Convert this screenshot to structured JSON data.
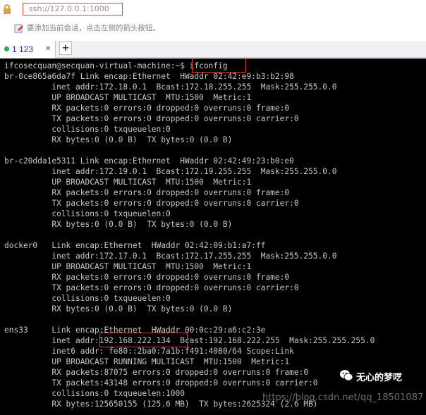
{
  "address_bar": {
    "url": "ssh://127.0.0.1:1000"
  },
  "hint": {
    "text": "要添加当前会话，点击左侧的箭头按钮。"
  },
  "tabs": [
    {
      "label": "1 123",
      "active": true
    }
  ],
  "new_tab_label": "+",
  "terminal": {
    "lines": [
      "ifcosecquan@secquan-virtual-machine:~$ ifconfig",
      "br-0ce865a6da7f Link encap:Ethernet  HWaddr 02:42:e9:b3:b2:98",
      "          inet addr:172.18.0.1  Bcast:172.18.255.255  Mask:255.255.0.0",
      "          UP BROADCAST MULTICAST  MTU:1500  Metric:1",
      "          RX packets:0 errors:0 dropped:0 overruns:0 frame:0",
      "          TX packets:0 errors:0 dropped:0 overruns:0 carrier:0",
      "          collisions:0 txqueuelen:0",
      "          RX bytes:0 (0.0 B)  TX bytes:0 (0.0 B)",
      "",
      "br-c20dda1e5311 Link encap:Ethernet  HWaddr 02:42:49:23:b0:e0",
      "          inet addr:172.19.0.1  Bcast:172.19.255.255  Mask:255.255.0.0",
      "          UP BROADCAST MULTICAST  MTU:1500  Metric:1",
      "          RX packets:0 errors:0 dropped:0 overruns:0 frame:0",
      "          TX packets:0 errors:0 dropped:0 overruns:0 carrier:0",
      "          collisions:0 txqueuelen:0",
      "          RX bytes:0 (0.0 B)  TX bytes:0 (0.0 B)",
      "",
      "docker0   Link encap:Ethernet  HWaddr 02:42:09:b1:a7:ff",
      "          inet addr:172.17.0.1  Bcast:172.17.255.255  Mask:255.255.0.0",
      "          UP BROADCAST MULTICAST  MTU:1500  Metric:1",
      "          RX packets:0 errors:0 dropped:0 overruns:0 frame:0",
      "          TX packets:0 errors:0 dropped:0 overruns:0 carrier:0",
      "          collisions:0 txqueuelen:0",
      "          RX bytes:0 (0.0 B)  TX bytes:0 (0.0 B)",
      "",
      "ens33     Link encap:Ethernet  HWaddr 00:0c:29:a6:c2:3e",
      "          inet addr:192.168.222.134  Bcast:192.168.222.255  Mask:255.255.255.0",
      "          inet6 addr: fe80::2ba0:7a1b:f491:4080/64 Scope:Link",
      "          UP BROADCAST RUNNING MULTICAST  MTU:1500  Metric:1",
      "          RX packets:87075 errors:0 dropped:0 overruns:0 frame:0",
      "          TX packets:43148 errors:0 dropped:0 overruns:0 carrier:0",
      "          collisions:0 txqueuelen:1000",
      "          RX bytes:125650155 (125.6 MB)  TX bytes:2625324 (2.6 MB)"
    ]
  },
  "watermarks": {
    "blog": "https://blog.csdn.net/qq_18501087",
    "wechat": "无心的梦呓"
  }
}
